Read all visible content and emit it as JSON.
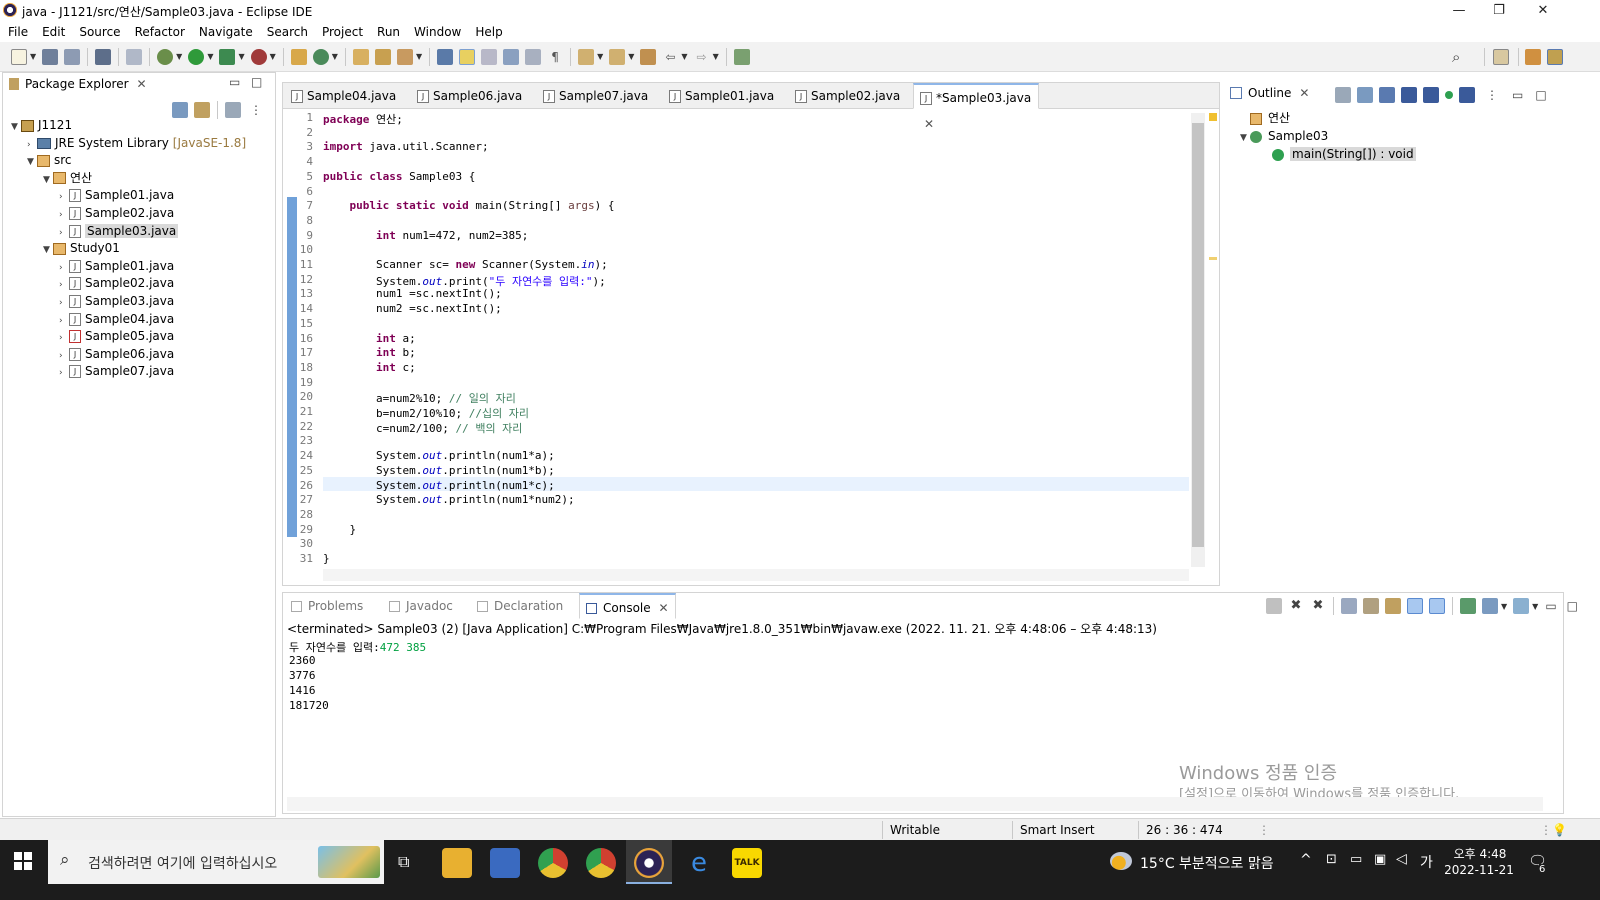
{
  "window": {
    "title": "java - J1121/src/연산/Sample03.java - Eclipse IDE",
    "controls": [
      "—",
      "❐",
      "✕"
    ]
  },
  "menu": [
    "File",
    "Edit",
    "Source",
    "Refactor",
    "Navigate",
    "Search",
    "Project",
    "Run",
    "Window",
    "Help"
  ],
  "package_explorer": {
    "title": "Package Explorer",
    "tree": [
      {
        "label": "J1121",
        "level": 0,
        "type": "project",
        "expanded": true
      },
      {
        "label": "JRE System Library",
        "suffix": "[JavaSE-1.8]",
        "level": 1,
        "type": "library",
        "expanded": false
      },
      {
        "label": "src",
        "level": 1,
        "type": "srcfolder",
        "expanded": true
      },
      {
        "label": "연산",
        "level": 2,
        "type": "package",
        "expanded": true
      },
      {
        "label": "Sample01.java",
        "level": 3,
        "type": "file"
      },
      {
        "label": "Sample02.java",
        "level": 3,
        "type": "file"
      },
      {
        "label": "Sample03.java",
        "level": 3,
        "type": "file",
        "selected": true
      },
      {
        "label": "Study01",
        "level": 2,
        "type": "package",
        "expanded": true
      },
      {
        "label": "Sample01.java",
        "level": 3,
        "type": "file"
      },
      {
        "label": "Sample02.java",
        "level": 3,
        "type": "file"
      },
      {
        "label": "Sample03.java",
        "level": 3,
        "type": "file"
      },
      {
        "label": "Sample04.java",
        "level": 3,
        "type": "file"
      },
      {
        "label": "Sample05.java",
        "level": 3,
        "type": "file-error"
      },
      {
        "label": "Sample06.java",
        "level": 3,
        "type": "file"
      },
      {
        "label": "Sample07.java",
        "level": 3,
        "type": "file"
      }
    ]
  },
  "editor": {
    "tabs": [
      {
        "label": "Sample04.java",
        "active": false
      },
      {
        "label": "Sample06.java",
        "active": false
      },
      {
        "label": "Sample07.java",
        "active": false
      },
      {
        "label": "Sample01.java",
        "active": false
      },
      {
        "label": "Sample02.java",
        "active": false
      },
      {
        "label": "*Sample03.java",
        "active": true
      }
    ],
    "lines": [
      "package 연산;",
      "",
      "import java.util.Scanner;",
      "",
      "public class Sample03 {",
      "",
      "    public static void main(String[] args) {",
      "",
      "        int num1=472, num2=385;",
      "",
      "        Scanner sc= new Scanner(System.in);",
      "        System.out.print(\"두 자연수를 입력:\");",
      "        num1 =sc.nextInt();",
      "        num2 =sc.nextInt();",
      "",
      "        int a;",
      "        int b;",
      "        int c;",
      "",
      "        a=num2%10; // 일의 자리",
      "        b=num2/10%10; //십의 자리",
      "        c=num2/100; // 백의 자리",
      "",
      "        System.out.println(num1*a);",
      "        System.out.println(num1*b);",
      "        System.out.println(num1*c);",
      "        System.out.println(num1*num2);",
      "",
      "    }",
      "",
      "}"
    ],
    "current_line": 26
  },
  "outline": {
    "title": "Outline",
    "items": [
      {
        "label": "연산",
        "level": 0,
        "type": "package"
      },
      {
        "label": "Sample03",
        "level": 0,
        "type": "class"
      },
      {
        "label": "main(String[]) : void",
        "level": 1,
        "type": "method",
        "selected": true
      }
    ]
  },
  "bottom": {
    "tabs": [
      {
        "label": "Problems",
        "active": false
      },
      {
        "label": "Javadoc",
        "active": false
      },
      {
        "label": "Declaration",
        "active": false
      },
      {
        "label": "Console",
        "active": true
      }
    ],
    "header": "<terminated> Sample03 (2) [Java Application] C:₩Program Files₩Java₩jre1.8.0_351₩bin₩javaw.exe  (2022. 11. 21. 오후 4:48:06 – 오후 4:48:13)",
    "prompt": "두 자연수를 입력:",
    "input": "472 385",
    "output": [
      "2360",
      "3776",
      "1416",
      "181720"
    ],
    "watermark_title": "Windows 정품 인증",
    "watermark_sub": "[설정]으로 이동하여 Windows를 정품 인증합니다."
  },
  "status": {
    "writable": "Writable",
    "insert_mode": "Smart Insert",
    "position": "26 : 36 : 474"
  },
  "taskbar": {
    "search_placeholder": "검색하려면 여기에 입력하십시오",
    "weather": "15°C  부분적으로 맑음",
    "ime": "가",
    "time": "오후 4:48",
    "date": "2022-11-21",
    "notifications": "6"
  },
  "colors": {
    "keyword": "#7f0055",
    "string": "#2a00ff",
    "comment": "#3f7f5f",
    "static_field": "#0000c0",
    "console_input": "#00a040",
    "taskbar": "#1c1c1c"
  }
}
